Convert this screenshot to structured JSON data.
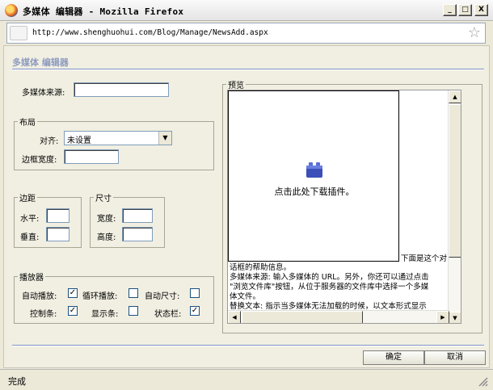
{
  "window": {
    "title": "多媒体 编辑器 - Mozilla Firefox",
    "minimize": "_",
    "maximize": "□",
    "close": "X"
  },
  "address": {
    "url": "http://www.shenghuohui.com/Blog/Manage/NewsAdd.aspx"
  },
  "dialog": {
    "title": "多媒体 编辑器",
    "source_label": "多媒体来源:",
    "source_value": "",
    "layout": {
      "legend": "布局",
      "align_label": "对齐:",
      "align_value": "未设置",
      "border_label": "边框宽度:",
      "border_value": ""
    },
    "spacing": {
      "legend": "边距",
      "h_label": "水平:",
      "v_label": "垂直:",
      "h_value": "",
      "v_value": ""
    },
    "size": {
      "legend": "尺寸",
      "w_label": "宽度:",
      "h_label": "高度:",
      "w_value": "",
      "h_value": ""
    },
    "player": {
      "legend": "播放器",
      "autoplay_label": "自动播放:",
      "loop_label": "循环播放:",
      "autosize_label": "自动尺寸:",
      "controls_label": "控制条:",
      "display_label": "显示条:",
      "status_label": "状态栏:",
      "autoplay": true,
      "loop": false,
      "autosize": false,
      "controls": true,
      "display": false,
      "status": true
    },
    "preview": {
      "legend": "预览",
      "plugin_text": "点击此处下载插件。",
      "side_text": "下面是这个对",
      "lines": [
        "话框的帮助信息。",
        "多媒体来源: 输入多媒体的 URL。另外，你还可以通过点击",
        "\"浏览文件库\"按钮，从位于服务器的文件库中选择一个多媒",
        "体文件。",
        "替换文本: 指示当多媒体无法加载的时候，以文本形式显示"
      ]
    },
    "ok_label": "确定",
    "cancel_label": "取消"
  },
  "statusbar": {
    "text": "完成"
  }
}
